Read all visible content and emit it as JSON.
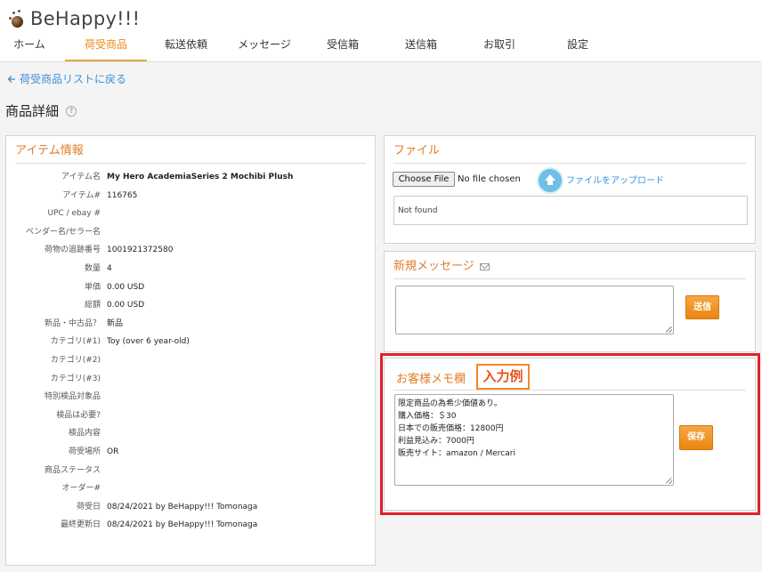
{
  "app": {
    "logo_text": "BeHappy!!!"
  },
  "nav": {
    "items": [
      {
        "label": "ホーム",
        "active": false
      },
      {
        "label": "荷受商品",
        "active": true
      },
      {
        "label": "転送依頼",
        "active": false
      },
      {
        "label": "メッセージ",
        "active": false
      },
      {
        "label": "受信箱",
        "active": false
      },
      {
        "label": "送信箱",
        "active": false
      },
      {
        "label": "お取引",
        "active": false
      },
      {
        "label": "設定",
        "active": false
      }
    ]
  },
  "back_link": "荷受商品リストに戻る",
  "page_title": "商品詳細",
  "item_panel": {
    "title": "アイテム情報",
    "rows": [
      {
        "label": "アイテム名",
        "value": "My Hero AcademiaSeries 2 Mochibi Plush",
        "bold": true
      },
      {
        "label": "アイテム#",
        "value": "116765"
      },
      {
        "label": "UPC / ebay #",
        "value": ""
      },
      {
        "label": "ベンダー名/セラー名",
        "value": ""
      },
      {
        "label": "荷物の追跡番号",
        "value": "1001921372580"
      },
      {
        "label": "数量",
        "value": "4"
      },
      {
        "label": "単価",
        "value": "0.00 USD"
      },
      {
        "label": "総額",
        "value": "0.00 USD"
      },
      {
        "label": "新品・中古品？",
        "value": "新品"
      },
      {
        "label": "カテゴリ(#1)",
        "value": "Toy (over 6 year-old)"
      },
      {
        "label": "カテゴリ(#2)",
        "value": ""
      },
      {
        "label": "カテゴリ(#3)",
        "value": ""
      },
      {
        "label": "特別検品対象品",
        "value": ""
      },
      {
        "label": "検品は必要?",
        "value": ""
      },
      {
        "label": "検品内容",
        "value": ""
      },
      {
        "label": "荷受場所",
        "value": "OR"
      },
      {
        "label": "商品ステータス",
        "value": ""
      },
      {
        "label": "オーダー#",
        "value": ""
      },
      {
        "label": "荷受日",
        "value": "08/24/2021 by BeHappy!!! Tomonaga"
      },
      {
        "label": "最終更新日",
        "value": "08/24/2021 by BeHappy!!! Tomonaga"
      }
    ]
  },
  "file_panel": {
    "title": "ファイル",
    "choose_button": "Choose File",
    "no_file_text": "No file chosen",
    "upload_link": "ファイルをアップロード",
    "list_text": "Not found"
  },
  "message_panel": {
    "title": "新規メッセージ",
    "textarea_value": "",
    "send_button": "送信"
  },
  "memo_panel": {
    "title": "お客様メモ欄",
    "example_badge": "入力例",
    "lines": [
      "限定商品の為希少価値あり。",
      "購入価格：＄30",
      "日本での販売価格：12800円",
      "利益見込み：7000円",
      "販売サイト：amazon / Mercari"
    ],
    "save_button": "保存"
  },
  "colors": {
    "accent_orange": "#e07d2a",
    "link_blue": "#3b8fd6",
    "button_orange": "#e98612",
    "highlight_red": "#e0202a"
  }
}
